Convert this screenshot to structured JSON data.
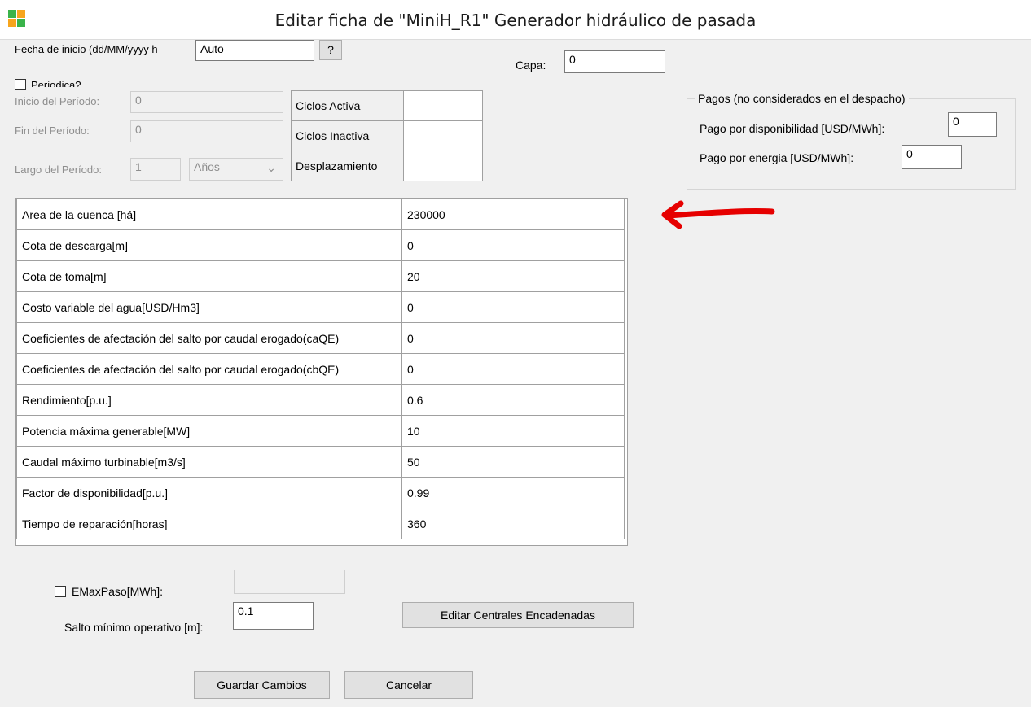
{
  "window": {
    "title": "Editar ficha de  \"MiniH_R1\" Generador hidráulico de pasada"
  },
  "header": {
    "start_date_label": "Fecha de inicio (dd/MM/yyyy h",
    "start_date_value": "Auto",
    "help_button": "?",
    "layer_label": "Capa:",
    "layer_value": "0"
  },
  "periodic": {
    "checkbox_label": "Periodica?",
    "start_label": "Inicio del Período:",
    "start_value": "0",
    "end_label": "Fin del Período:",
    "end_value": "0",
    "length_label": "Largo del Período:",
    "length_value": "1",
    "unit_value": "Años"
  },
  "cycles": [
    {
      "label": "Ciclos Activa",
      "value": ""
    },
    {
      "label": "Ciclos Inactiva",
      "value": ""
    },
    {
      "label": "Desplazamiento",
      "value": ""
    }
  ],
  "payments": {
    "group_title": "Pagos (no considerados en el despacho)",
    "availability_label": "Pago por disponibilidad [USD/MWh]:",
    "availability_value": "0",
    "energy_label": "Pago por energia  [USD/MWh]:",
    "energy_value": "0"
  },
  "parameters": [
    {
      "name": "Area de la cuenca [há]",
      "value": "230000"
    },
    {
      "name": "Cota de descarga[m]",
      "value": "0"
    },
    {
      "name": "Cota de toma[m]",
      "value": "20"
    },
    {
      "name": "Costo variable del agua[USD/Hm3]",
      "value": "0"
    },
    {
      "name": "Coeficientes de afectación del salto por caudal erogado(caQE)",
      "value": "0"
    },
    {
      "name": "Coeficientes de afectación del salto por caudal erogado(cbQE)",
      "value": "0"
    },
    {
      "name": "Rendimiento[p.u.]",
      "value": "0.6"
    },
    {
      "name": "Potencia máxima generable[MW]",
      "value": "10"
    },
    {
      "name": "Caudal máximo turbinable[m3/s]",
      "value": "50"
    },
    {
      "name": "Factor de disponibilidad[p.u.]",
      "value": "0.99"
    },
    {
      "name": "Tiempo de reparación[horas]",
      "value": "360"
    }
  ],
  "bottom": {
    "emax_label": "EMaxPaso[MWh]:",
    "emax_value": "",
    "salto_label": "Salto mínimo operativo [m]:",
    "salto_value": "0.1",
    "chained_button": "Editar Centrales Encadenadas",
    "save_button": "Guardar Cambios",
    "cancel_button": "Cancelar"
  },
  "colors": {
    "annotation_arrow": "#e60000",
    "icon_green": "#3ab34a",
    "icon_orange": "#f7a51d"
  },
  "icons": [
    "app-icon",
    "help-icon",
    "dropdown-chevron-icon",
    "annotation-arrow-icon"
  ]
}
